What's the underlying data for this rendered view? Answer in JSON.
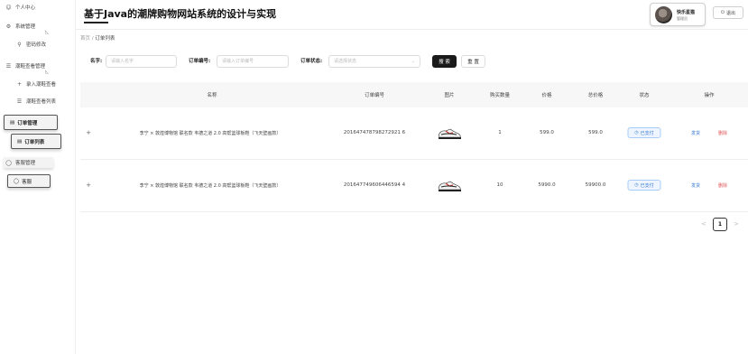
{
  "app": {
    "title": "基于Java的潮牌购物网站系统的设计与实现"
  },
  "header": {
    "user_name": "快乐星猫",
    "user_role": "管理员",
    "logout_label": "退出"
  },
  "sidebar": {
    "items": [
      {
        "label": "个人中心",
        "icon": "person-icon"
      },
      {
        "label": "系统管理",
        "icon": "gear-icon"
      },
      {
        "label": "密码修改",
        "icon": "key-icon"
      },
      {
        "label": "潮鞋查看管理",
        "icon": "list-icon"
      },
      {
        "label": "录入潮鞋查看",
        "icon": "plus-icon"
      },
      {
        "label": "潮鞋查看列表",
        "icon": "list-icon"
      },
      {
        "label": "订单管理",
        "icon": "document-icon"
      },
      {
        "label": "订单列表",
        "icon": "document-icon"
      },
      {
        "label": "客服管理",
        "icon": "chat-icon"
      },
      {
        "label": "客服",
        "icon": "chat-icon"
      }
    ]
  },
  "breadcrumb": {
    "home": "首页",
    "separator": "/",
    "current": "订单列表"
  },
  "search": {
    "name_label": "名字:",
    "name_placeholder": "请输入名字",
    "order_no_label": "订单编号:",
    "order_no_placeholder": "请输入订单编号",
    "status_label": "订单状态:",
    "status_placeholder": "请选择状态",
    "search_button": "搜 索",
    "reset_button": "重 置"
  },
  "table": {
    "columns": [
      "名称",
      "订单编号",
      "图片",
      "购买数量",
      "价格",
      "总价格",
      "状态",
      "操作"
    ],
    "rows": [
      {
        "expand": "+",
        "name": "李宁 × 敦煌博物馆 联名款 韦德之道 2.0 高帮篮球板鞋（飞天壁画款）",
        "order_no": "201647478798272921 6",
        "quantity": "1",
        "price": "599.0",
        "total": "599.0",
        "status": "已支付",
        "action_edit": "发货",
        "action_delete": "删除"
      },
      {
        "expand": "+",
        "name": "李宁 × 敦煌博物馆 联名款 韦德之道 2.0 高帮篮球板鞋（飞天壁画款）",
        "order_no": "201647749606446594 4",
        "quantity": "10",
        "price": "5990.0",
        "total": "59900.0",
        "status": "已支付",
        "action_edit": "发货",
        "action_delete": "删除"
      }
    ]
  },
  "pagination": {
    "prev": "<",
    "current_page": "1",
    "next": ">"
  },
  "colors": {
    "accent_blue": "#3a7bd5",
    "danger_red": "#e05555",
    "primary_button": "#1a1a1a"
  }
}
